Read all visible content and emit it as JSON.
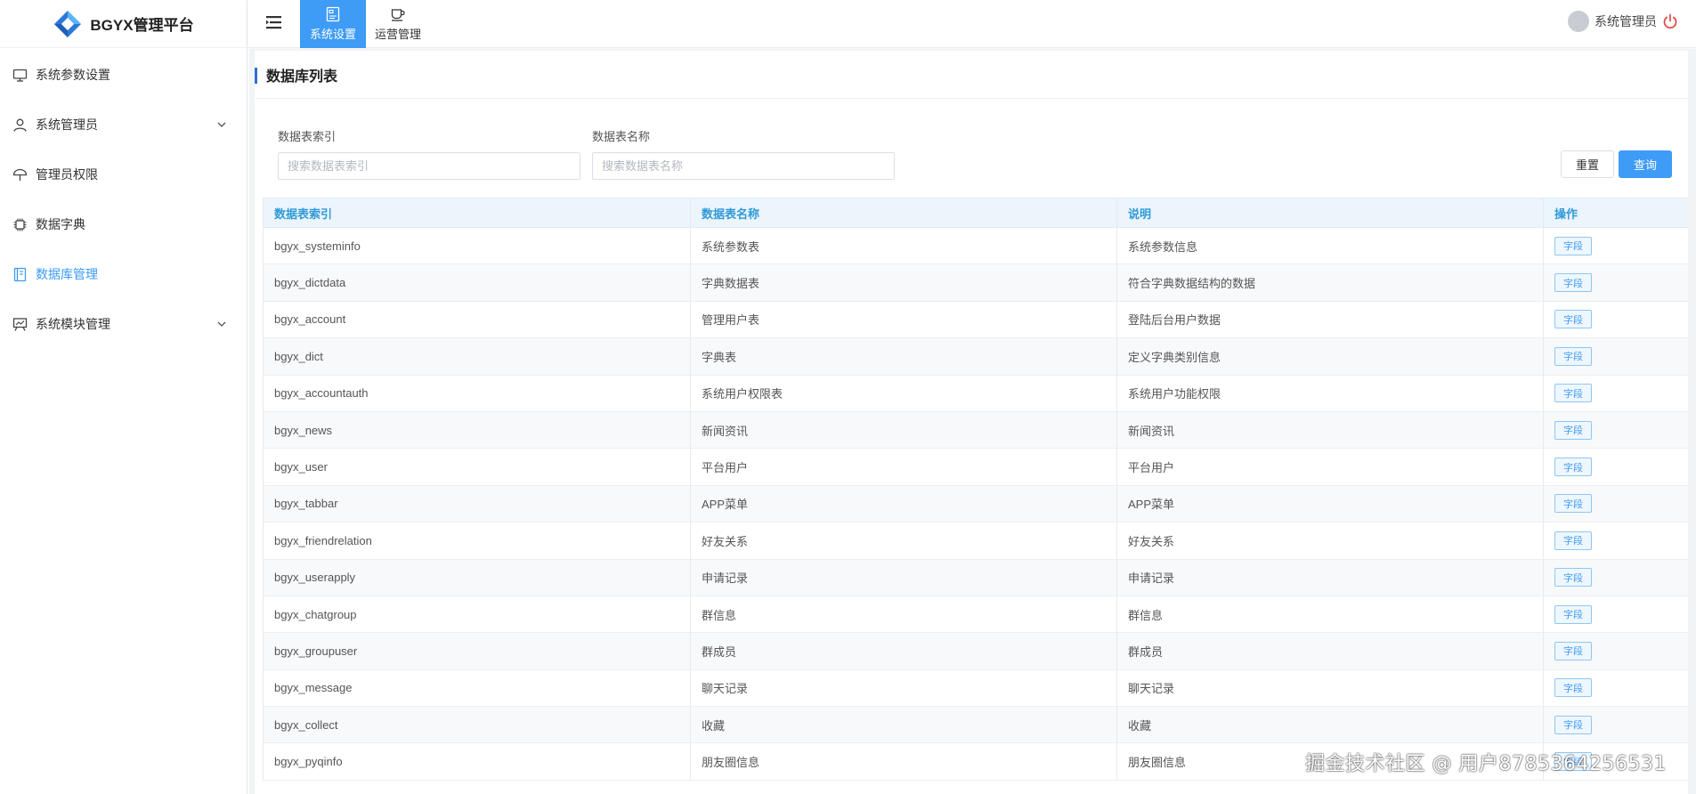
{
  "app": {
    "title": "BGYX管理平台"
  },
  "sidebar": {
    "items": [
      {
        "label": "系统参数设置",
        "icon": "monitor-icon",
        "expandable": false,
        "active": false
      },
      {
        "label": "系统管理员",
        "icon": "user-icon",
        "expandable": true,
        "active": false
      },
      {
        "label": "管理员权限",
        "icon": "umbrella-icon",
        "expandable": false,
        "active": false
      },
      {
        "label": "数据字典",
        "icon": "chip-icon",
        "expandable": false,
        "active": false
      },
      {
        "label": "数据库管理",
        "icon": "book-icon",
        "expandable": false,
        "active": true
      },
      {
        "label": "系统模块管理",
        "icon": "presentation-icon",
        "expandable": true,
        "active": false
      }
    ]
  },
  "topbar": {
    "tabs": [
      {
        "label": "系统设置",
        "icon": "settings-panel-icon",
        "active": true
      },
      {
        "label": "运营管理",
        "icon": "coffee-icon",
        "active": false
      }
    ],
    "user": {
      "name": "系统管理员"
    }
  },
  "main": {
    "title": "数据库列表",
    "filters": {
      "index": {
        "label": "数据表索引",
        "placeholder": "搜索数据表索引",
        "value": ""
      },
      "name": {
        "label": "数据表名称",
        "placeholder": "搜索数据表名称",
        "value": ""
      }
    },
    "buttons": {
      "reset": "重置",
      "query": "查询"
    },
    "table": {
      "columns": [
        "数据表索引",
        "数据表名称",
        "说明",
        "操作"
      ],
      "action_label": "字段",
      "rows": [
        [
          "bgyx_systeminfo",
          "系统参数表",
          "系统参数信息"
        ],
        [
          "bgyx_dictdata",
          "字典数据表",
          "符合字典数据结构的数据"
        ],
        [
          "bgyx_account",
          "管理用户表",
          "登陆后台用户数据"
        ],
        [
          "bgyx_dict",
          "字典表",
          "定义字典类别信息"
        ],
        [
          "bgyx_accountauth",
          "系统用户权限表",
          "系统用户功能权限"
        ],
        [
          "bgyx_news",
          "新闻资讯",
          "新闻资讯"
        ],
        [
          "bgyx_user",
          "平台用户",
          "平台用户"
        ],
        [
          "bgyx_tabbar",
          "APP菜单",
          "APP菜单"
        ],
        [
          "bgyx_friendrelation",
          "好友关系",
          "好友关系"
        ],
        [
          "bgyx_userapply",
          "申请记录",
          "申请记录"
        ],
        [
          "bgyx_chatgroup",
          "群信息",
          "群信息"
        ],
        [
          "bgyx_groupuser",
          "群成员",
          "群成员"
        ],
        [
          "bgyx_message",
          "聊天记录",
          "聊天记录"
        ],
        [
          "bgyx_collect",
          "收藏",
          "收藏"
        ],
        [
          "bgyx_pyqinfo",
          "朋友圈信息",
          "朋友圈信息"
        ]
      ]
    }
  },
  "watermark": "掘金技术社区 @ 用户8785364256531",
  "colors": {
    "accent": "#3e9bf6",
    "header_text": "#2f9ad8",
    "title_bar": "#2d6fd6"
  }
}
